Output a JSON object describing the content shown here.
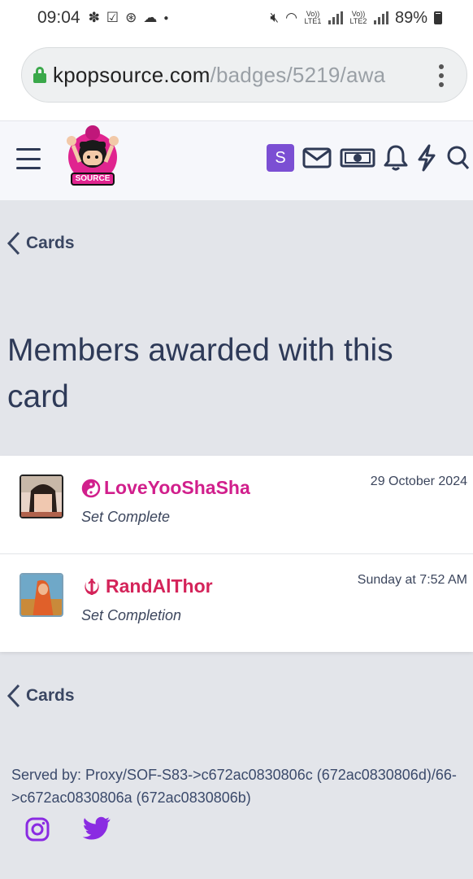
{
  "status_bar": {
    "time": "09:04",
    "left_icons": [
      "pinwheel-icon",
      "checkbox-icon",
      "sync-icon",
      "cloud-icon",
      "dot-icon"
    ],
    "volte1": "Vo)) LTE1",
    "volte2": "Vo)) LTE2",
    "battery": "89%"
  },
  "browser": {
    "url_host": "kpopsource.com",
    "url_path": "/badges/5219/awa"
  },
  "header": {
    "user_initial": "S",
    "icons": [
      "hamburger-icon",
      "mail-icon",
      "money-icon",
      "bell-icon",
      "lightning-icon",
      "search-icon"
    ],
    "logo_text": "SOURCE"
  },
  "breadcrumb_top": "Cards",
  "page_title": "Members awarded with this card",
  "awards": [
    {
      "username": "LoveYooShaSha",
      "title": "Set Complete",
      "date": "29 October 2024",
      "color": "#d11f8c"
    },
    {
      "username": "RandAlThor",
      "title": "Set Completion",
      "date": "Sunday at 7:52 AM",
      "color": "#d4245a"
    }
  ],
  "breadcrumb_bottom": "Cards",
  "footer": {
    "served_by": "Served by: Proxy/SOF-S83->c672ac0830806c (672ac0830806d)/66->c672ac0830806a (672ac0830806b)",
    "social": [
      "instagram-icon",
      "twitter-icon"
    ],
    "social_color": "#8a2be2"
  },
  "colors": {
    "background": "#e3e5ea",
    "accent": "#7b4fd3",
    "text": "#2e3a58"
  }
}
